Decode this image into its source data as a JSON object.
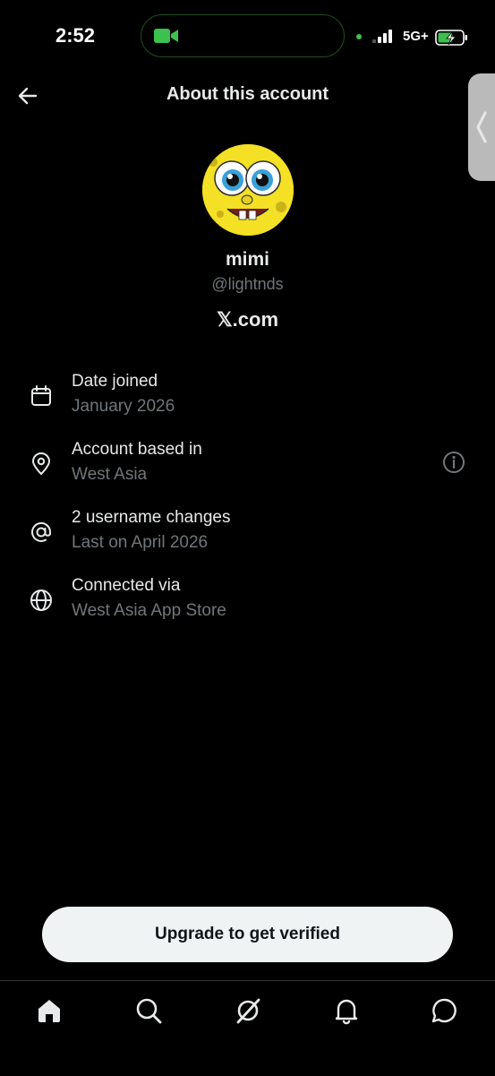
{
  "status_bar": {
    "time": "2:52",
    "network": "5G+"
  },
  "header": {
    "title": "About this account"
  },
  "profile": {
    "name": "mimi",
    "handle": "@lightnds",
    "site": "𝕏.com"
  },
  "info_items": [
    {
      "icon": "calendar-icon",
      "label": "Date joined",
      "value": "January 2026"
    },
    {
      "icon": "location-pin-icon",
      "label": "Account based in",
      "value": "West Asia"
    },
    {
      "icon": "at-sign-icon",
      "label": "2 username changes",
      "value": "Last on April 2026"
    },
    {
      "icon": "globe-icon",
      "label": "Connected via",
      "value": "West Asia App Store"
    }
  ],
  "cta": {
    "label": "Upgrade to get verified"
  },
  "bottom_nav": [
    "home-icon",
    "search-icon",
    "grok-icon",
    "notifications-icon",
    "messages-icon"
  ],
  "colors": {
    "background": "#000000",
    "text_primary": "#e7e9ea",
    "text_secondary": "#71767b",
    "button_bg": "#eff3f4",
    "facetime_green": "#3cc04f"
  }
}
